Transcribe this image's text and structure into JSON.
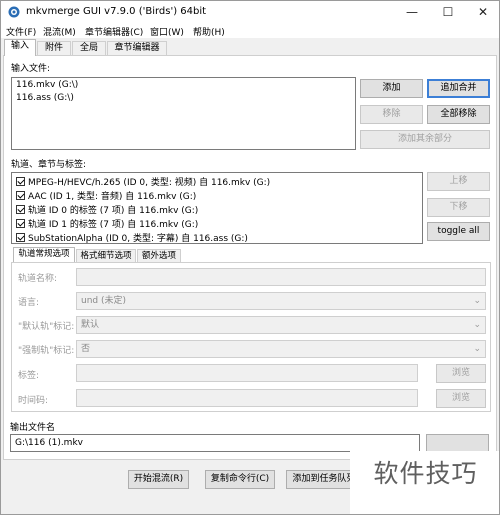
{
  "window": {
    "title": "mkvmerge GUI v7.9.0 ('Birds') 64bit"
  },
  "window_controls": {
    "minimize": "—",
    "maximize": "☐",
    "close": "✕"
  },
  "menu": [
    "文件(F)",
    "混流(M)",
    "章节编辑器(C)",
    "窗口(W)",
    "帮助(H)"
  ],
  "tabs": [
    "输入",
    "附件",
    "全局",
    "章节编辑器"
  ],
  "input_files": {
    "label": "输入文件:",
    "files": [
      "116.mkv (G:\\)",
      "116.ass (G:\\)"
    ],
    "buttons": {
      "add": "添加",
      "append": "追加合并",
      "remove": "移除",
      "remove_all": "全部移除",
      "add_parts": "添加其余部分"
    }
  },
  "tracks": {
    "label": "轨道、章节与标签:",
    "items": [
      "MPEG-H/HEVC/h.265 (ID 0, 类型: 视频) 自 116.mkv (G:)",
      "AAC (ID 1, 类型: 音频) 自 116.mkv (G:)",
      "轨道 ID 0 的标签 (7 项) 自 116.mkv (G:)",
      "轨道 ID 1 的标签 (7 项) 自 116.mkv (G:)",
      "SubStationAlpha (ID 0, 类型: 字幕) 自 116.ass (G:)"
    ],
    "buttons": {
      "up": "上移",
      "down": "下移",
      "toggle_all": "toggle all"
    }
  },
  "subtabs": [
    "轨道常规选项",
    "格式细节选项",
    "额外选项"
  ],
  "general_options": {
    "track_name_label": "轨道名称:",
    "language_label": "语言:",
    "language_value": "und (未定)",
    "default_flag_label": "\"默认轨\"标记:",
    "default_flag_value": "默认",
    "forced_flag_label": "\"强制轨\"标记:",
    "forced_flag_value": "否",
    "tags_label": "标签:",
    "timecodes_label": "时间码:",
    "browse": "浏览"
  },
  "output": {
    "label": "输出文件名",
    "filename": "G:\\116 (1).mkv"
  },
  "bottom_buttons": {
    "start": "开始混流(R)",
    "copy_cmd": "复制命令行(C)",
    "add_job": "添加到任务队列"
  },
  "watermark": "软件技巧"
}
